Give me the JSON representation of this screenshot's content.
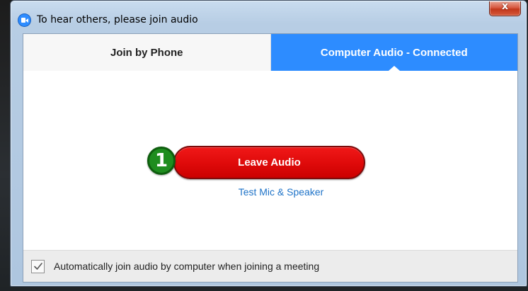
{
  "window": {
    "title": "To hear others, please join audio",
    "close_symbol": "x",
    "app_icon": "zoom-camera-icon"
  },
  "tabs": [
    {
      "label": "Join by Phone",
      "active": false
    },
    {
      "label": "Computer Audio - Connected",
      "active": true
    }
  ],
  "main": {
    "step_marker": "1",
    "leave_button_label": "Leave Audio",
    "test_link_label": "Test Mic & Speaker"
  },
  "footer": {
    "auto_join_checked": true,
    "auto_join_label": "Automatically join audio by computer when joining a meeting"
  },
  "colors": {
    "accent": "#2d8cff",
    "leave_red": "#e00b0b",
    "step_green": "#1f8d1f",
    "link_blue": "#1e73c8"
  }
}
